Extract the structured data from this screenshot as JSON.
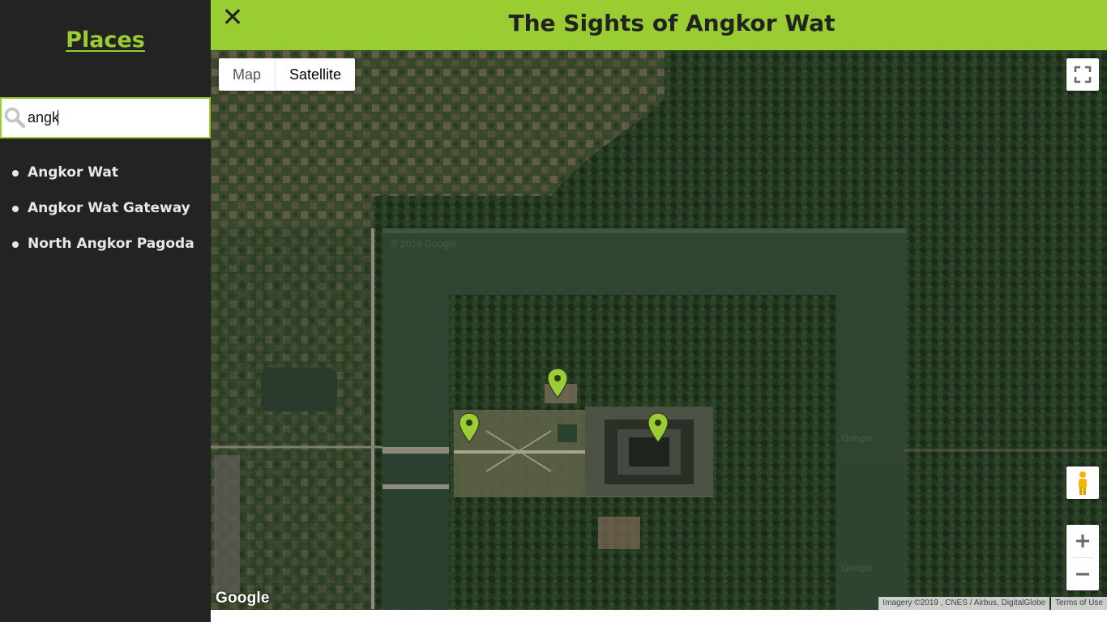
{
  "sidebar": {
    "title": "Places",
    "search": {
      "value": "angk",
      "placeholder": ""
    },
    "items": [
      {
        "label": "Angkor Wat"
      },
      {
        "label": "Angkor Wat Gateway"
      },
      {
        "label": "North Angkor Pagoda"
      }
    ]
  },
  "header": {
    "close_label": "✕",
    "title": "The Sights of Angkor Wat"
  },
  "map": {
    "map_type": {
      "map_label": "Map",
      "satellite_label": "Satellite",
      "selected": "Satellite"
    },
    "google_logo": "Google",
    "attribution": "Imagery ©2019 , CNES / Airbus, DigitalGlobe",
    "terms": "Terms of Use",
    "watermark": "© 2019 Google",
    "watermark_short": "Google",
    "marker_count": 3
  },
  "colors": {
    "accent": "#9acd32",
    "sidebar_bg": "#232323",
    "sidebar_text": "#e8e8e8",
    "header_text": "#222222"
  },
  "icons": {
    "search": "magnifier-icon",
    "close": "close-icon",
    "fullscreen": "fullscreen-icon",
    "pegman": "street-view-pegman-icon",
    "zoom_in": "plus-icon",
    "zoom_out": "minus-icon",
    "marker": "map-pin-icon"
  }
}
